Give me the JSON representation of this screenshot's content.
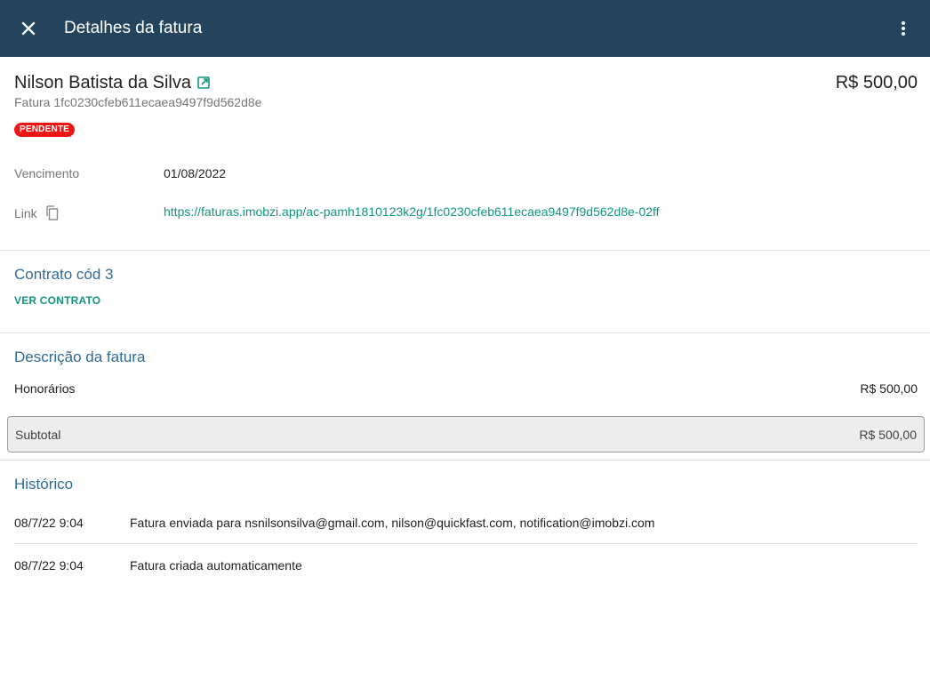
{
  "appbar": {
    "title": "Detalhes da fatura",
    "close_icon": "close-icon",
    "more_icon": "more-vertical-icon",
    "background": "#24435c"
  },
  "invoice": {
    "client_name": "Nilson Batista da Silva",
    "amount": "R$ 500,00",
    "id_text": "Fatura 1fc0230cfeb611ecaea9497f9d562d8e",
    "status": "PENDENTE",
    "status_color": "#f01515"
  },
  "fields": {
    "due_label": "Vencimento",
    "due_value": "01/08/2022",
    "link_label": "Link",
    "link_value": "https://faturas.imobzi.app/ac-pamh1810123k2g/1fc0230cfeb611ecaea9497f9d562d8e-02ff"
  },
  "contract": {
    "title": "Contrato cód 3",
    "button": "VER CONTRATO"
  },
  "description": {
    "title": "Descrição da fatura",
    "items": [
      {
        "label": "Honorários",
        "value": "R$ 500,00"
      }
    ],
    "subtotal_label": "Subtotal",
    "subtotal_value": "R$ 500,00"
  },
  "history": {
    "title": "Histórico",
    "entries": [
      {
        "date": "08/7/22 9:04",
        "text": "Fatura enviada para nsnilsonsilva@gmail.com, nilson@quickfast.com, notification@imobzi.com"
      },
      {
        "date": "08/7/22 9:04",
        "text": "Fatura criada automaticamente"
      }
    ]
  },
  "colors": {
    "accent_green": "#12977d",
    "section_blue": "#2f6b97"
  }
}
